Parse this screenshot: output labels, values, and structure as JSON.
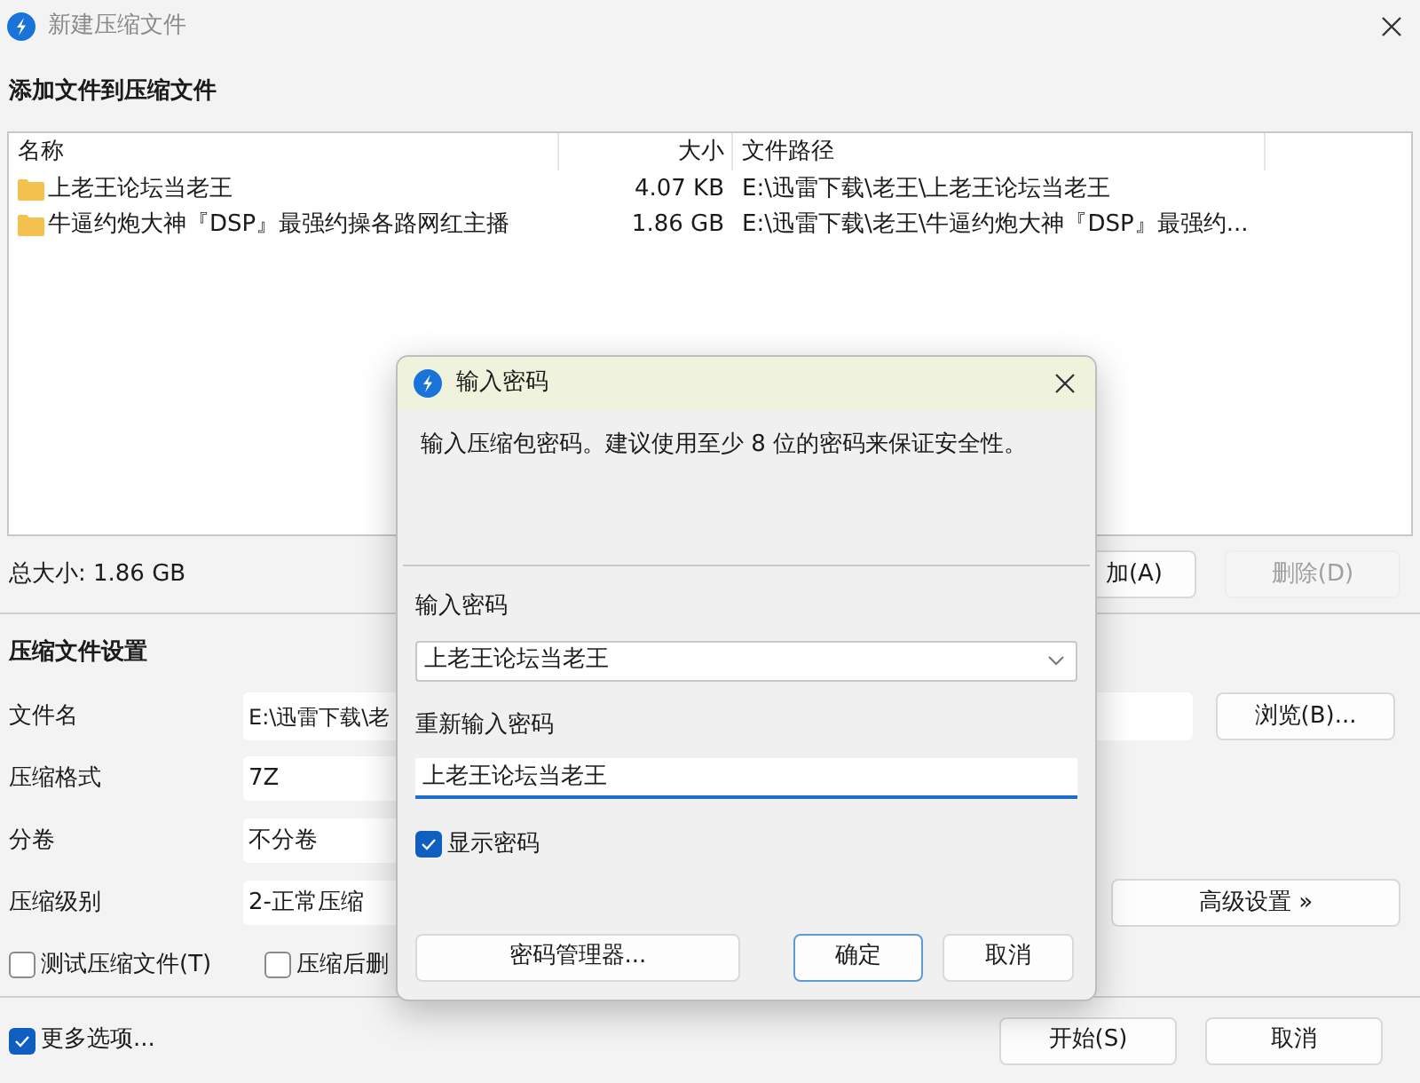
{
  "window": {
    "title": "新建压缩文件"
  },
  "files_section": {
    "heading": "添加文件到压缩文件",
    "columns": [
      "名称",
      "大小",
      "文件路径"
    ],
    "rows": [
      {
        "name": "上老王论坛当老王",
        "size": "4.07 KB",
        "path": "E:\\迅雷下载\\老王\\上老王论坛当老王"
      },
      {
        "name": "牛逼约炮大神『DSP』最强约操各路网红主播",
        "size": "1.86 GB",
        "path": "E:\\迅雷下载\\老王\\牛逼约炮大神『DSP』最强约..."
      }
    ],
    "total_size": "总大小: 1.86 GB",
    "buttons": [
      {
        "label": "加(A)",
        "disabled": false
      },
      {
        "label": "删除(D)",
        "disabled": true
      }
    ]
  },
  "settings": {
    "heading": "压缩文件设置",
    "fields": [
      {
        "label": "文件名",
        "value": "E:\\迅雷下载\\老",
        "kind": "text"
      },
      {
        "label": "压缩格式",
        "value": "7Z",
        "kind": "select"
      },
      {
        "label": "分卷",
        "value": "不分卷",
        "kind": "select"
      },
      {
        "label": "压缩级别",
        "value": "2-正常压缩",
        "kind": "select"
      }
    ],
    "browse_button": "浏览(B)...",
    "advanced_button": "高级设置 »",
    "options": [
      {
        "label": "测试压缩文件(T)",
        "checked": false
      },
      {
        "label": "压缩后删",
        "checked": false
      }
    ]
  },
  "footer": {
    "more_options": {
      "label": "更多选项...",
      "checked": true
    },
    "buttons": [
      "开始(S)",
      "取消"
    ]
  },
  "dialog": {
    "title": "输入密码",
    "message": "输入压缩包密码。建议使用至少 8 位的密码来保证安全性。",
    "password_label": "输入密码",
    "password_value": "上老王论坛当老王",
    "confirm_label": "重新输入密码",
    "confirm_value": "上老王论坛当老王",
    "show_password": {
      "label": "显示密码",
      "checked": true
    },
    "buttons": [
      {
        "label": "密码管理器...",
        "default": false
      },
      {
        "label": "确定",
        "default": true
      },
      {
        "label": "取消",
        "default": false
      }
    ]
  }
}
